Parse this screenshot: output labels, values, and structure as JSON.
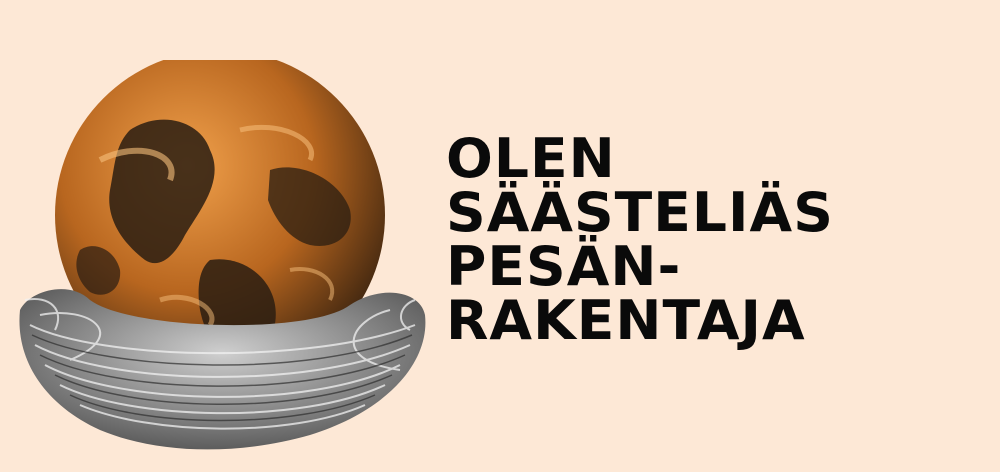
{
  "headline": {
    "lines": [
      "OLEN",
      "SÄÄSTELIÄS",
      "PESÄN-",
      "RAKENTAJA"
    ]
  },
  "colors": {
    "background": "#fde8d6",
    "globe_orange": "#e9923a",
    "globe_dark": "#2a1d12",
    "nest_gray": "#8a8a8a",
    "text": "#0a0a0a"
  },
  "icons": {
    "illustration": "earth-globe-in-nest-icon"
  }
}
